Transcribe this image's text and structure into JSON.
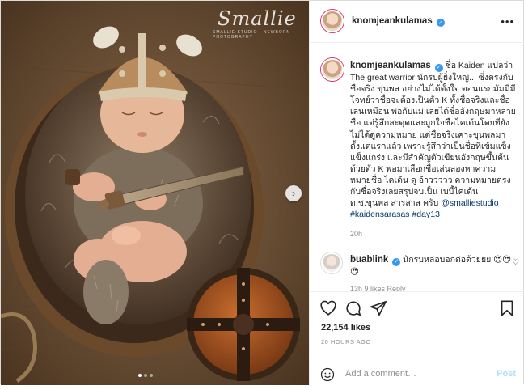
{
  "photo": {
    "watermark": "Smallie",
    "watermark_sub": "SMALLIE STUDIO · NEWBORN PHOTOGRAPHY",
    "next_icon": "chevron-right-icon",
    "carousel": {
      "count": 3,
      "active": 1
    }
  },
  "header": {
    "username": "knomjeankulamas",
    "verified": "✓",
    "more": "•••"
  },
  "caption": {
    "username": "knomjeankulamas",
    "verified": "✓",
    "text": "ชื่อ Kaiden แปลว่า The great warrior นักรบผู้ยิ่งใหญ่... ซึ่งตรงกับชื่อจริง ขุนพล อย่างไม่ได้ตั้งใจ ตอนแรกมัมมี่มีโจทย์ว่าชื่อจะต้องเป็นตัว K ทั้งชื่อจริงและชื่อเล่นเหมือน พ่อกับแม่ เลยได้ชื่ออังกฤษมาหลายชื่อ แต่รู้สึกสะดุดและถูกใจชื่อไคเด้นโดยที่ยังไม่ได้ดูความหมาย แต่ชื่อจริงเคาะขุนพลมาตั้งแต่แรกแล้ว เพราะรู้สึกว่าเป็นชื่อที่เข้มแข็งแข็งแกร่ง และมีสำคัญตัวเขียนอังกฤษขึ้นต้นด้วยตัว K พอมาเลือกชื่อเล่นลองหาความหมายชื่อ ไคเด้น ดู อ้าววววว ความหมายตรงกับชื่อจริงเลยสรุปจบเป็น เบบี้ไคเด้น ด.ช.ขุนพล สารสาส ครับ",
    "tags": "@smalliestudio #kaidensarasas #day13",
    "time": "20h"
  },
  "comment": {
    "username": "buablink",
    "verified": "✓",
    "text": "นักรบหล่อบอกต่อด้วยยย 😍😍😍",
    "meta": "13h   9 likes   Reply"
  },
  "actions": {
    "likes": "22,154 likes",
    "ago": "20 HOURS AGO"
  },
  "add_comment": {
    "placeholder": "Add a comment…",
    "post_label": "Post"
  },
  "colors": {
    "verified": "#3897f0",
    "link": "#00376b",
    "post_disabled": "#b2dffc"
  }
}
